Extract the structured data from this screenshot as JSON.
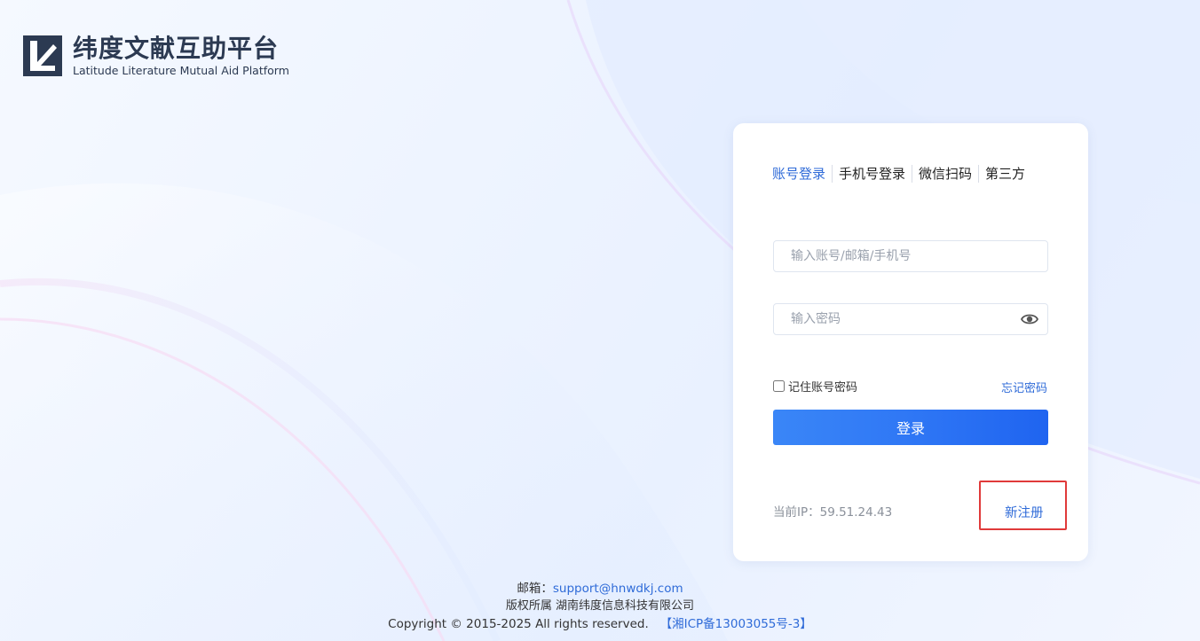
{
  "brand": {
    "name_cn": "纬度文献互助平台",
    "name_en": "Latitude Literature Mutual Aid Platform"
  },
  "login": {
    "tabs": [
      {
        "label": "账号登录",
        "active": true
      },
      {
        "label": "手机号登录",
        "active": false
      },
      {
        "label": "微信扫码",
        "active": false
      },
      {
        "label": "第三方",
        "active": false
      }
    ],
    "account_placeholder": "输入账号/邮箱/手机号",
    "password_placeholder": "输入密码",
    "remember_label": "记住账号密码",
    "forgot_label": "忘记密码",
    "submit_label": "登录",
    "ip_text": "当前IP：59.51.24.43",
    "register_label": "新注册"
  },
  "footer": {
    "email_label": "邮箱：",
    "email": "support@hnwdkj.com",
    "owner_line": "版权所属 湖南纬度信息科技有限公司",
    "copyright": "Copyright © 2015-2025 All rights reserved.",
    "icp": "【湘ICP备13003055号-3】"
  },
  "colors": {
    "accent": "#2f6bd8",
    "button": "#2f77f5",
    "highlight": "#e03a3a",
    "brand_dark": "#2c3a52"
  },
  "icons": [
    "logo-mark-icon",
    "eye-icon"
  ]
}
